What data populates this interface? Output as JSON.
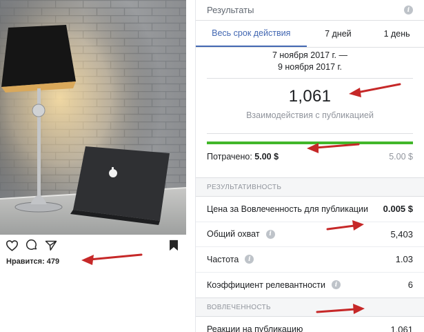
{
  "instagram": {
    "likes_text": "Нравится: 479",
    "icons": [
      "heart-icon",
      "comment-icon",
      "share-icon",
      "bookmark-icon"
    ]
  },
  "panel": {
    "title": "Результаты",
    "tabs": [
      {
        "label": "Весь срок действия",
        "active": true
      },
      {
        "label": "7 дней",
        "active": false
      },
      {
        "label": "1 день",
        "active": false
      }
    ],
    "date_line1": "7 ноября 2017 г. —",
    "date_line2": "9 ноября 2017 г.",
    "main_metric": {
      "value": "1,061",
      "label": "Взаимодействия с публикацией"
    },
    "budget": {
      "spent_label": "Потрачено:",
      "spent_value": "5.00 $",
      "total": "5.00 $",
      "fill_fraction": 1.0
    },
    "performance": {
      "heading": "РЕЗУЛЬТАТИВНОСТЬ",
      "rows": [
        {
          "label": "Цена за Вовлеченность для публикации",
          "value": "0.005 $",
          "has_info": false,
          "value_bold": true
        },
        {
          "label": "Общий охват",
          "value": "5,403",
          "has_info": true,
          "value_bold": false
        },
        {
          "label": "Частота",
          "value": "1.03",
          "has_info": true,
          "value_bold": false
        },
        {
          "label": "Коэффициент релевантности",
          "value": "6",
          "has_info": true,
          "value_bold": false
        }
      ]
    },
    "engagement": {
      "heading": "ВОВЛЕЧЕННОСТЬ",
      "rows": [
        {
          "label": "Реакции на публикацию",
          "value": "1,061"
        }
      ]
    }
  },
  "colors": {
    "accent": "#4267b2",
    "budget_bar": "#42b72a",
    "annotation_arrow": "#c62828"
  }
}
